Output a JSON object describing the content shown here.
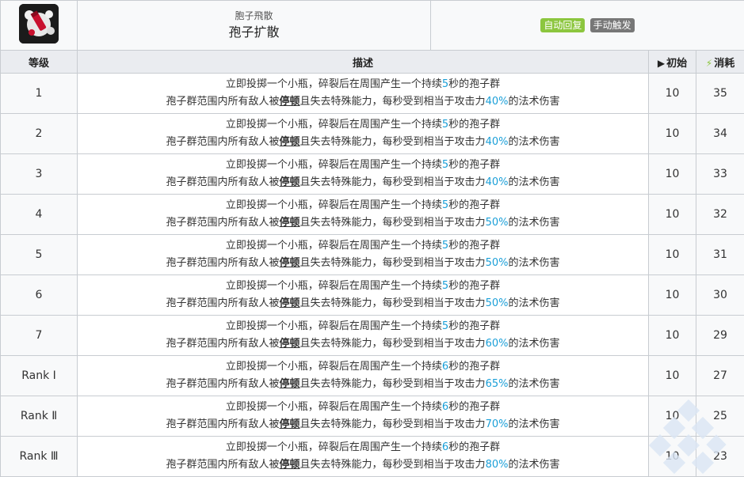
{
  "skill": {
    "icon": "spore-bottle-icon",
    "original_name": "胞子飛散",
    "name": "孢子扩散",
    "tags": [
      "自动回复",
      "手动触发"
    ]
  },
  "columns": {
    "level": "等级",
    "description": "描述",
    "initial": "初始",
    "cost": "消耗"
  },
  "rows": [
    {
      "level": "1",
      "line1_prefix": "立即投掷一个小瓶，碎裂后在周围产生一个持续",
      "duration": "5",
      "line1_suffix": "秒的孢子群",
      "line2_prefix": "孢子群范围内所有敌人被",
      "keyword": "停顿",
      "line2_mid": "且失去特殊能力，每秒受到相当于攻击力",
      "percent": "40%",
      "line2_suffix": "的法术伤害",
      "initial": "10",
      "cost": "35"
    },
    {
      "level": "2",
      "line1_prefix": "立即投掷一个小瓶，碎裂后在周围产生一个持续",
      "duration": "5",
      "line1_suffix": "秒的孢子群",
      "line2_prefix": "孢子群范围内所有敌人被",
      "keyword": "停顿",
      "line2_mid": "且失去特殊能力，每秒受到相当于攻击力",
      "percent": "40%",
      "line2_suffix": "的法术伤害",
      "initial": "10",
      "cost": "34"
    },
    {
      "level": "3",
      "line1_prefix": "立即投掷一个小瓶，碎裂后在周围产生一个持续",
      "duration": "5",
      "line1_suffix": "秒的孢子群",
      "line2_prefix": "孢子群范围内所有敌人被",
      "keyword": "停顿",
      "line2_mid": "且失去特殊能力，每秒受到相当于攻击力",
      "percent": "40%",
      "line2_suffix": "的法术伤害",
      "initial": "10",
      "cost": "33"
    },
    {
      "level": "4",
      "line1_prefix": "立即投掷一个小瓶，碎裂后在周围产生一个持续",
      "duration": "5",
      "line1_suffix": "秒的孢子群",
      "line2_prefix": "孢子群范围内所有敌人被",
      "keyword": "停顿",
      "line2_mid": "且失去特殊能力，每秒受到相当于攻击力",
      "percent": "50%",
      "line2_suffix": "的法术伤害",
      "initial": "10",
      "cost": "32"
    },
    {
      "level": "5",
      "line1_prefix": "立即投掷一个小瓶，碎裂后在周围产生一个持续",
      "duration": "5",
      "line1_suffix": "秒的孢子群",
      "line2_prefix": "孢子群范围内所有敌人被",
      "keyword": "停顿",
      "line2_mid": "且失去特殊能力，每秒受到相当于攻击力",
      "percent": "50%",
      "line2_suffix": "的法术伤害",
      "initial": "10",
      "cost": "31"
    },
    {
      "level": "6",
      "line1_prefix": "立即投掷一个小瓶，碎裂后在周围产生一个持续",
      "duration": "5",
      "line1_suffix": "秒的孢子群",
      "line2_prefix": "孢子群范围内所有敌人被",
      "keyword": "停顿",
      "line2_mid": "且失去特殊能力，每秒受到相当于攻击力",
      "percent": "50%",
      "line2_suffix": "的法术伤害",
      "initial": "10",
      "cost": "30"
    },
    {
      "level": "7",
      "line1_prefix": "立即投掷一个小瓶，碎裂后在周围产生一个持续",
      "duration": "5",
      "line1_suffix": "秒的孢子群",
      "line2_prefix": "孢子群范围内所有敌人被",
      "keyword": "停顿",
      "line2_mid": "且失去特殊能力，每秒受到相当于攻击力",
      "percent": "60%",
      "line2_suffix": "的法术伤害",
      "initial": "10",
      "cost": "29"
    },
    {
      "level": "Rank Ⅰ",
      "line1_prefix": "立即投掷一个小瓶，碎裂后在周围产生一个持续",
      "duration": "6",
      "line1_suffix": "秒的孢子群",
      "line2_prefix": "孢子群范围内所有敌人被",
      "keyword": "停顿",
      "line2_mid": "且失去特殊能力，每秒受到相当于攻击力",
      "percent": "65%",
      "line2_suffix": "的法术伤害",
      "initial": "10",
      "cost": "27"
    },
    {
      "level": "Rank Ⅱ",
      "line1_prefix": "立即投掷一个小瓶，碎裂后在周围产生一个持续",
      "duration": "6",
      "line1_suffix": "秒的孢子群",
      "line2_prefix": "孢子群范围内所有敌人被",
      "keyword": "停顿",
      "line2_mid": "且失去特殊能力，每秒受到相当于攻击力",
      "percent": "70%",
      "line2_suffix": "的法术伤害",
      "initial": "10",
      "cost": "25"
    },
    {
      "level": "Rank Ⅲ",
      "line1_prefix": "立即投掷一个小瓶，碎裂后在周围产生一个持续",
      "duration": "6",
      "line1_suffix": "秒的孢子群",
      "line2_prefix": "孢子群范围内所有敌人被",
      "keyword": "停顿",
      "line2_mid": "且失去特殊能力，每秒受到相当于攻击力",
      "percent": "80%",
      "line2_suffix": "的法术伤害",
      "initial": "10",
      "cost": "23"
    }
  ],
  "colors": {
    "accent_blue": "#1a9fd8",
    "tag_green": "#8cc63e",
    "tag_gray": "#777777",
    "header_bg": "#eaecf0"
  }
}
